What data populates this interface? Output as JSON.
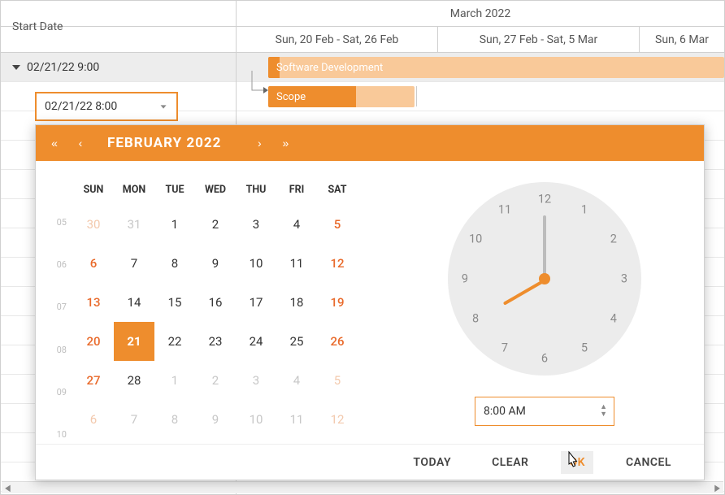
{
  "grid": {
    "column_left_header": "Start Date",
    "month_header": "March 2022",
    "week_headers": [
      "Sun, 20 Feb - Sat, 26 Feb",
      "Sun, 27 Feb - Sat, 5 Mar",
      "Sun, 6 Mar"
    ],
    "rows": [
      {
        "value": "02/21/22 9:00",
        "bar_label": "Software Development"
      },
      {
        "value": "02/21/22 8:00",
        "bar_label": "Scope"
      }
    ],
    "editor_value": "02/21/22 8:00"
  },
  "picker": {
    "title": "FEBRUARY 2022",
    "dow": [
      "SUN",
      "MON",
      "TUE",
      "WED",
      "THU",
      "FRI",
      "SAT"
    ],
    "week_numbers": [
      "05",
      "06",
      "07",
      "08",
      "09",
      "10"
    ],
    "days": [
      [
        {
          "n": "30",
          "c": "wk-other"
        },
        {
          "n": "31",
          "c": "other"
        },
        {
          "n": "1",
          "c": ""
        },
        {
          "n": "2",
          "c": ""
        },
        {
          "n": "3",
          "c": ""
        },
        {
          "n": "4",
          "c": ""
        },
        {
          "n": "5",
          "c": "wk"
        }
      ],
      [
        {
          "n": "6",
          "c": "wk"
        },
        {
          "n": "7",
          "c": ""
        },
        {
          "n": "8",
          "c": ""
        },
        {
          "n": "9",
          "c": ""
        },
        {
          "n": "10",
          "c": ""
        },
        {
          "n": "11",
          "c": ""
        },
        {
          "n": "12",
          "c": "wk"
        }
      ],
      [
        {
          "n": "13",
          "c": "wk"
        },
        {
          "n": "14",
          "c": ""
        },
        {
          "n": "15",
          "c": ""
        },
        {
          "n": "16",
          "c": ""
        },
        {
          "n": "17",
          "c": ""
        },
        {
          "n": "18",
          "c": ""
        },
        {
          "n": "19",
          "c": "wk"
        }
      ],
      [
        {
          "n": "20",
          "c": "wk"
        },
        {
          "n": "21",
          "c": "sel"
        },
        {
          "n": "22",
          "c": ""
        },
        {
          "n": "23",
          "c": ""
        },
        {
          "n": "24",
          "c": ""
        },
        {
          "n": "25",
          "c": ""
        },
        {
          "n": "26",
          "c": "wk"
        }
      ],
      [
        {
          "n": "27",
          "c": "wk"
        },
        {
          "n": "28",
          "c": ""
        },
        {
          "n": "1",
          "c": "other"
        },
        {
          "n": "2",
          "c": "other"
        },
        {
          "n": "3",
          "c": "other"
        },
        {
          "n": "4",
          "c": "other"
        },
        {
          "n": "5",
          "c": "wk-other"
        }
      ],
      [
        {
          "n": "6",
          "c": "wk-other"
        },
        {
          "n": "7",
          "c": "other"
        },
        {
          "n": "8",
          "c": "other"
        },
        {
          "n": "9",
          "c": "other"
        },
        {
          "n": "10",
          "c": "other"
        },
        {
          "n": "11",
          "c": "other"
        },
        {
          "n": "12",
          "c": "wk-other"
        }
      ]
    ],
    "clock_numbers": [
      "12",
      "1",
      "2",
      "3",
      "4",
      "5",
      "6",
      "7",
      "8",
      "9",
      "10",
      "11"
    ],
    "time_value": "8:00 AM",
    "hour_angle": 240,
    "minute_angle": 0,
    "footer": {
      "today": "TODAY",
      "clear": "CLEAR",
      "ok": "OK",
      "cancel": "CANCEL"
    }
  },
  "colors": {
    "accent": "#ee8d2d"
  }
}
